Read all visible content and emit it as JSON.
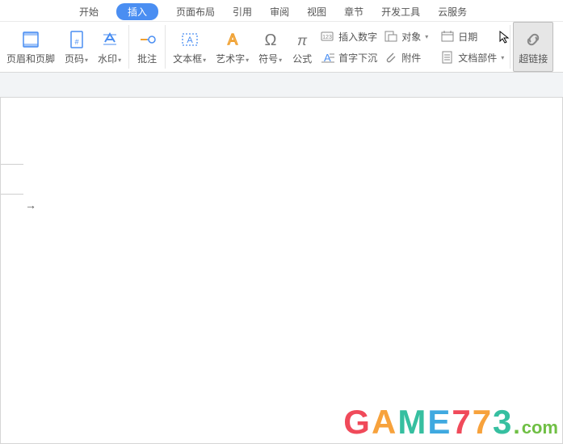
{
  "tabs": {
    "start": "开始",
    "insert": "插入",
    "layout": "页面布局",
    "reference": "引用",
    "review": "审阅",
    "view": "视图",
    "chapter": "章节",
    "dev": "开发工具",
    "cloud": "云服务"
  },
  "ribbon": {
    "header_footer": "页眉和页脚",
    "page_number": "页码",
    "watermark": "水印",
    "comment": "批注",
    "textbox": "文本框",
    "wordart": "艺术字",
    "symbol": "符号",
    "formula": "公式",
    "insert_number": "插入数字",
    "object": "对象",
    "date": "日期",
    "dropcap": "首字下沉",
    "attachment": "附件",
    "doc_parts": "文档部件",
    "hyperlink": "超链接"
  },
  "document": {
    "arrow_glyph": "→"
  },
  "watermark": {
    "g": "G",
    "a": "A",
    "m": "M",
    "e": "E",
    "n7": "7",
    "n72": "7",
    "n3": "3",
    "dot": ".",
    "com": "com"
  }
}
